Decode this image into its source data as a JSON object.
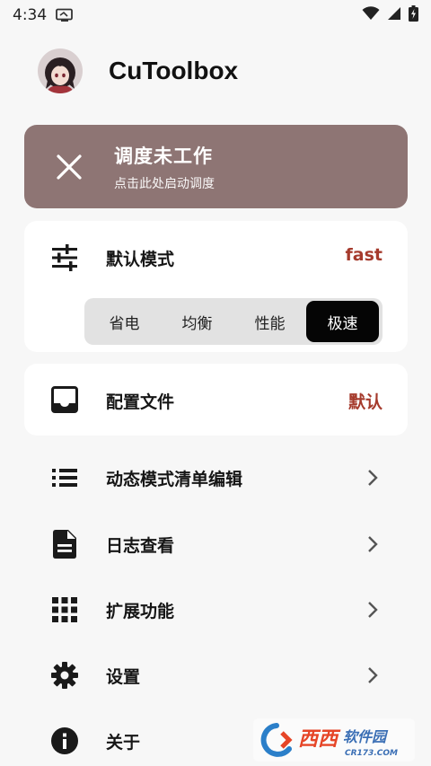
{
  "status_bar": {
    "time": "4:34",
    "icons": [
      "screen-cast-icon",
      "wifi-icon",
      "signal-icon",
      "battery-charging-icon"
    ]
  },
  "header": {
    "app_title": "CuToolbox",
    "avatar": "anime-girl-avatar"
  },
  "scheduler_banner": {
    "title": "调度未工作",
    "subtitle": "点击此处启动调度",
    "icon": "close-icon",
    "background_color": "#8e7574"
  },
  "default_mode": {
    "label": "默认模式",
    "value": "fast",
    "icon": "tune-sliders-icon",
    "options": [
      "省电",
      "均衡",
      "性能",
      "极速"
    ],
    "selected_option": "极速"
  },
  "config_file": {
    "label": "配置文件",
    "value": "默认",
    "icon": "inbox-tray-icon"
  },
  "menu": [
    {
      "label": "动态模式清单编辑",
      "icon": "list-icon",
      "has_chevron": true
    },
    {
      "label": "日志查看",
      "icon": "document-icon",
      "has_chevron": true
    },
    {
      "label": "扩展功能",
      "icon": "apps-grid-icon",
      "has_chevron": true
    },
    {
      "label": "设置",
      "icon": "gear-icon",
      "has_chevron": true
    },
    {
      "label": "关于",
      "icon": "info-icon",
      "has_chevron": false
    }
  ],
  "accent_color": "#a53a2c",
  "watermark": {
    "brand": "西西软件园",
    "domain": "CR173.COM"
  }
}
